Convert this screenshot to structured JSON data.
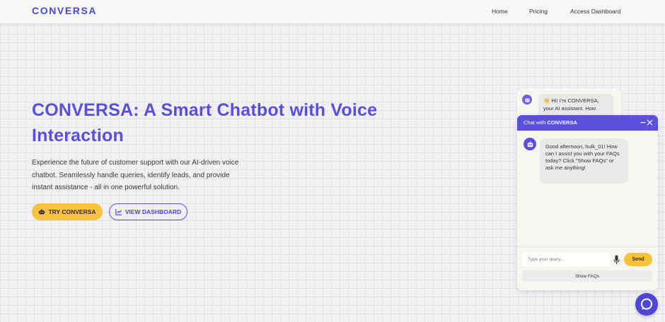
{
  "colors": {
    "brand": "#4f45d6",
    "accent_yellow": "#f8c33a",
    "chat_header": "#5b4fdd"
  },
  "header": {
    "logo": "CONVERSA",
    "nav": [
      {
        "label": "Home"
      },
      {
        "label": "Pricing"
      },
      {
        "label": "Access Dashboard"
      }
    ]
  },
  "hero": {
    "title": "CONVERSA: A Smart Chatbot with Voice Interaction",
    "description": "Experience the future of customer support with our AI-driven voice chatbot. Seamlessly handle queries, identify leads, and provide instant assistance - all in one powerful solution.",
    "try_button": {
      "label": "TRY CONVERSA",
      "icon": "robot-icon"
    },
    "view_button": {
      "label": "VIEW DASHBOARD",
      "icon": "chart-icon"
    }
  },
  "preview": {
    "message": "👋 Hi! I'm CONVERSA, your AI assistant. How"
  },
  "chat": {
    "title_prefix": "Chat with ",
    "title_brand": "CONVERSA",
    "bot_message": "Good afternoon, hulk_01! How can I assist you with your FAQs today? Click \"Show FAQs\" or ask me anything!",
    "input_placeholder": "Type your query...",
    "send_label": "Send",
    "faq_label": "Show FAQs"
  }
}
